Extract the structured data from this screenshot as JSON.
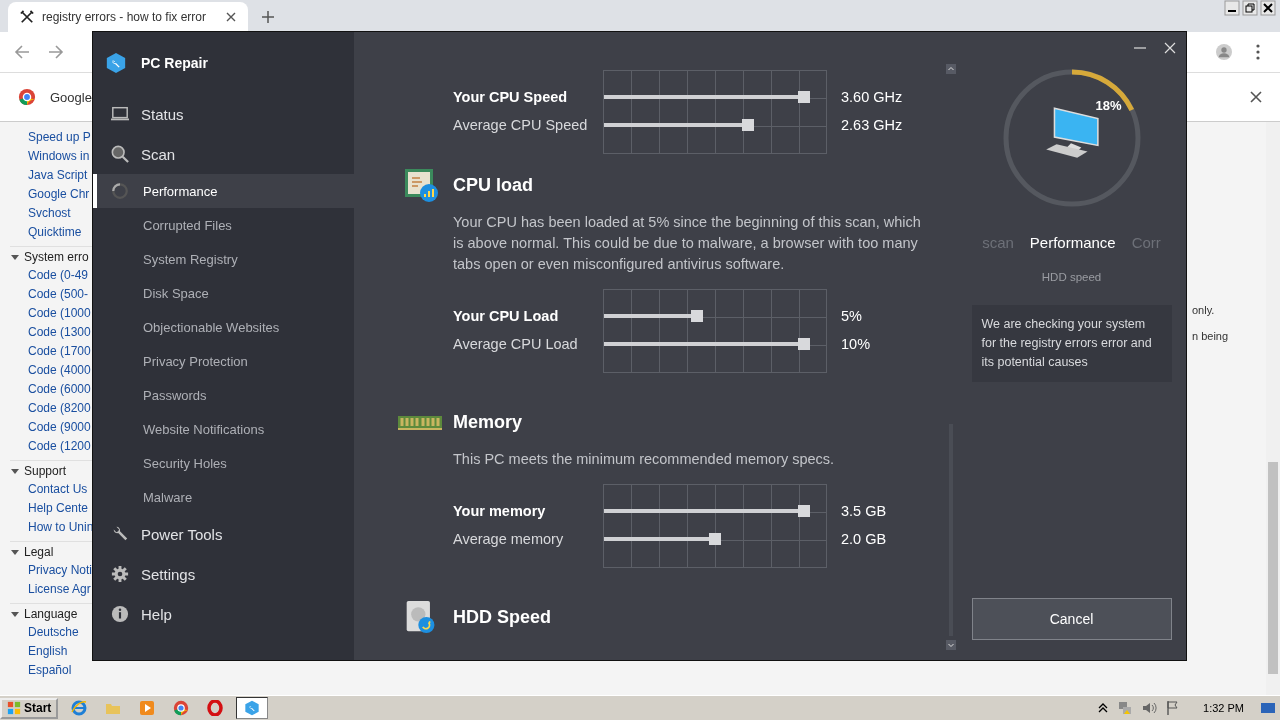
{
  "browser": {
    "tab_title": "registry errors - how to fix error",
    "bookmark": "Google",
    "tree": [
      {
        "label": "Speed up P"
      },
      {
        "label": "Windows in"
      },
      {
        "label": "Java Script"
      },
      {
        "label": "Google Chr"
      },
      {
        "label": "Svchost"
      },
      {
        "label": "Quicktime"
      },
      {
        "label": "System erro",
        "expanded": true,
        "children": [
          {
            "label": "Code (0-49"
          },
          {
            "label": "Code (500-"
          },
          {
            "label": "Code (1000"
          },
          {
            "label": "Code (1300"
          },
          {
            "label": "Code (1700"
          },
          {
            "label": "Code (4000"
          },
          {
            "label": "Code (6000"
          },
          {
            "label": "Code (8200"
          },
          {
            "label": "Code (9000"
          },
          {
            "label": "Code (1200"
          }
        ]
      },
      {
        "label": "Support",
        "expanded": true,
        "children": [
          {
            "label": "Contact Us"
          },
          {
            "label": "Help Cente"
          },
          {
            "label": "How to Unin"
          }
        ]
      },
      {
        "label": "Legal",
        "expanded": true,
        "children": [
          {
            "label": "Privacy Noti"
          },
          {
            "label": "License Agr"
          }
        ]
      },
      {
        "label": "Language",
        "expanded": true,
        "children": [
          {
            "label": "Deutsche"
          },
          {
            "label": "English"
          },
          {
            "label": "Español"
          }
        ]
      }
    ],
    "page_fragments": [
      "only.",
      "n being"
    ]
  },
  "app": {
    "title": "PC Repair",
    "nav": [
      {
        "label": "Status",
        "kind": "status",
        "selected": false
      },
      {
        "label": "Scan",
        "kind": "scan",
        "selected": false
      },
      {
        "label": "Performance",
        "kind": "progress",
        "selected": true
      },
      {
        "label": "Corrupted Files",
        "kind": "step",
        "selected": false
      },
      {
        "label": "System Registry",
        "kind": "step",
        "selected": false
      },
      {
        "label": "Disk Space",
        "kind": "step",
        "selected": false
      },
      {
        "label": "Objectionable Websites",
        "kind": "step",
        "selected": false
      },
      {
        "label": "Privacy Protection",
        "kind": "step",
        "selected": false
      },
      {
        "label": "Passwords",
        "kind": "step",
        "selected": false
      },
      {
        "label": "Website Notifications",
        "kind": "step",
        "selected": false
      },
      {
        "label": "Security Holes",
        "kind": "step",
        "selected": false
      },
      {
        "label": "Malware",
        "kind": "step",
        "selected": false
      },
      {
        "label": "Power Tools",
        "kind": "tools",
        "selected": false
      },
      {
        "label": "Settings",
        "kind": "settings",
        "selected": false
      },
      {
        "label": "Help",
        "kind": "help",
        "selected": false
      }
    ],
    "sections": [
      {
        "rows": [
          {
            "label": "Your CPU Speed",
            "emphasized": true,
            "level": 0.9,
            "reading": "3.60 GHz"
          },
          {
            "label": "Average CPU Speed",
            "emphasized": false,
            "level": 0.65,
            "reading": "2.63 GHz"
          }
        ]
      },
      {
        "kind": "cpu",
        "title": "CPU load",
        "description": "Your CPU has been loaded at 5% since the beginning of this scan, which is above normal. This could be due to malware, a browser with too many tabs open or even misconfigured antivirus software.",
        "rows": [
          {
            "label": "Your CPU Load",
            "emphasized": true,
            "level": 0.42,
            "reading": "5%"
          },
          {
            "label": "Average CPU Load",
            "emphasized": false,
            "level": 0.9,
            "reading": "10%"
          }
        ]
      },
      {
        "kind": "memory",
        "title": "Memory",
        "description": "This PC meets the minimum recommended memory specs.",
        "rows": [
          {
            "label": "Your memory",
            "emphasized": true,
            "level": 0.9,
            "reading": "3.5 GB"
          },
          {
            "label": "Average memory",
            "emphasized": false,
            "level": 0.5,
            "reading": "2.0 GB"
          }
        ]
      },
      {
        "kind": "hdd",
        "title": "HDD Speed"
      }
    ],
    "progress": {
      "level": 0.18,
      "reading": "18%"
    },
    "steps": [
      {
        "label": "scan",
        "selected": false
      },
      {
        "label": "Performance",
        "selected": true
      },
      {
        "label": "Corr",
        "selected": false
      }
    ],
    "step_detail": "HDD speed",
    "info": "We are checking your system for the registry errors error and its potential causes",
    "cancel": "Cancel"
  },
  "taskbar": {
    "start": "Start",
    "apps": [
      {
        "kind": "ie",
        "selected": false
      },
      {
        "kind": "folder",
        "selected": false
      },
      {
        "kind": "media",
        "selected": false
      },
      {
        "kind": "chrome",
        "selected": false
      },
      {
        "kind": "opera",
        "selected": false
      },
      {
        "kind": "repair",
        "selected": true
      }
    ],
    "clock": "1:32 PM"
  }
}
